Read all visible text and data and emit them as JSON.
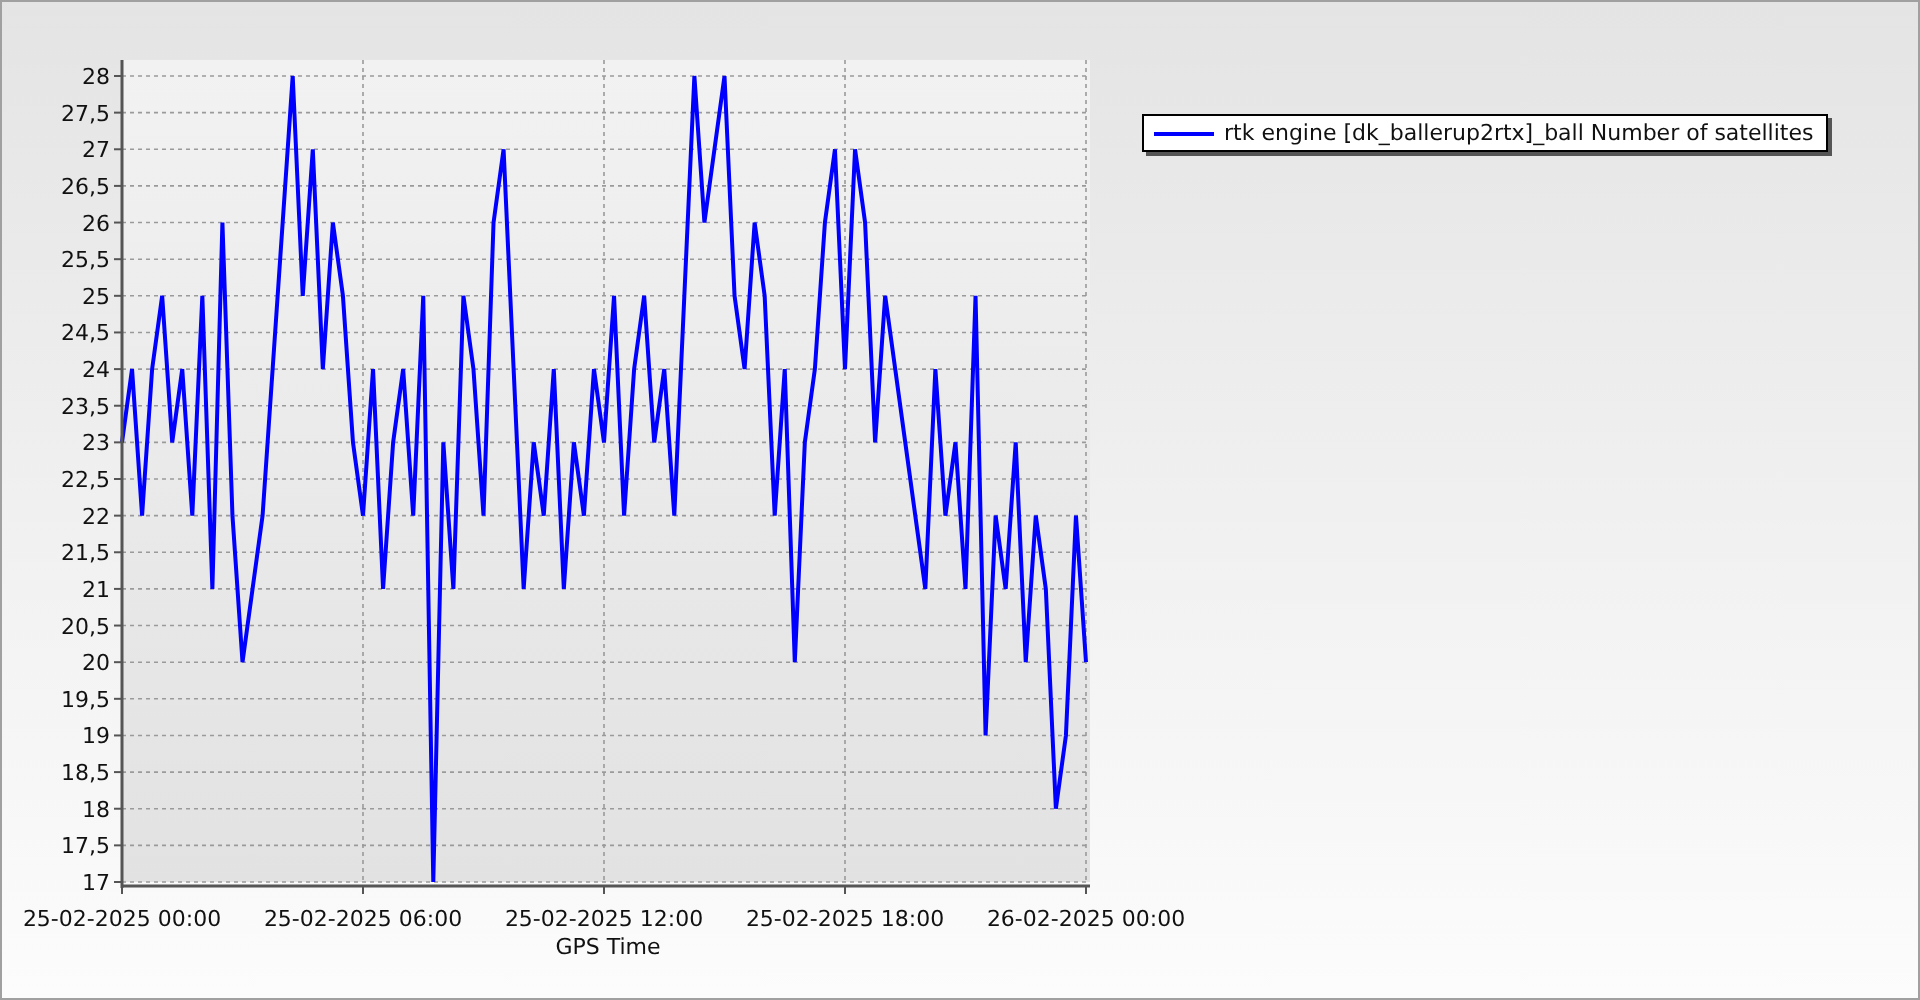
{
  "chart_data": {
    "type": "line",
    "xlabel": "GPS Time",
    "categories": [
      "25-02-2025 00:00",
      null,
      null,
      null,
      null,
      null,
      null,
      null,
      null,
      null,
      null,
      null,
      null,
      null,
      null,
      null,
      null,
      null,
      null,
      null,
      null,
      null,
      null,
      null,
      "25-02-2025 06:00",
      null,
      null,
      null,
      null,
      null,
      null,
      null,
      null,
      null,
      null,
      null,
      null,
      null,
      null,
      null,
      null,
      null,
      null,
      null,
      null,
      null,
      null,
      null,
      "25-02-2025 12:00",
      null,
      null,
      null,
      null,
      null,
      null,
      null,
      null,
      null,
      null,
      null,
      null,
      null,
      null,
      null,
      null,
      null,
      null,
      null,
      null,
      null,
      null,
      null,
      "25-02-2025 18:00",
      null,
      null,
      null,
      null,
      null,
      null,
      null,
      null,
      null,
      null,
      null,
      null,
      null,
      null,
      null,
      null,
      null,
      null,
      null,
      null,
      null,
      null,
      null,
      "26-02-2025 00:00"
    ],
    "series": [
      {
        "name": "rtk engine [dk_ballerup2rtx]_ball Number of satellites",
        "color": "#0000ff",
        "values": [
          23,
          24,
          22,
          24,
          25,
          23,
          24,
          22,
          25,
          21,
          26,
          22,
          20,
          21,
          22,
          24,
          26,
          28,
          25,
          27,
          24,
          26,
          25,
          23,
          22,
          24,
          21,
          23,
          24,
          22,
          25,
          17,
          23,
          21,
          25,
          24,
          22,
          26,
          27,
          24,
          21,
          23,
          22,
          24,
          21,
          23,
          22,
          24,
          23,
          25,
          22,
          24,
          25,
          23,
          24,
          22,
          25,
          28,
          26,
          27,
          28,
          25,
          24,
          26,
          25,
          22,
          24,
          20,
          23,
          24,
          26,
          27,
          24,
          27,
          26,
          23,
          25,
          24,
          23,
          22,
          21,
          24,
          22,
          23,
          21,
          25,
          19,
          22,
          21,
          23,
          20,
          22,
          21,
          18,
          19,
          22,
          20
        ]
      }
    ],
    "ylim": [
      17,
      28
    ],
    "grid": true,
    "yticks": [
      {
        "value": 17,
        "label": "17"
      },
      {
        "value": 17.5,
        "label": "17,5"
      },
      {
        "value": 18,
        "label": "18"
      },
      {
        "value": 18.5,
        "label": "18,5"
      },
      {
        "value": 19,
        "label": "19"
      },
      {
        "value": 19.5,
        "label": "19,5"
      },
      {
        "value": 20,
        "label": "20"
      },
      {
        "value": 20.5,
        "label": "20,5"
      },
      {
        "value": 21,
        "label": "21"
      },
      {
        "value": 21.5,
        "label": "21,5"
      },
      {
        "value": 22,
        "label": "22"
      },
      {
        "value": 22.5,
        "label": "22,5"
      },
      {
        "value": 23,
        "label": "23"
      },
      {
        "value": 23.5,
        "label": "23,5"
      },
      {
        "value": 24,
        "label": "24"
      },
      {
        "value": 24.5,
        "label": "24,5"
      },
      {
        "value": 25,
        "label": "25"
      },
      {
        "value": 25.5,
        "label": "25,5"
      },
      {
        "value": 26,
        "label": "26"
      },
      {
        "value": 26.5,
        "label": "26,5"
      },
      {
        "value": 27,
        "label": "27"
      },
      {
        "value": 27.5,
        "label": "27,5"
      },
      {
        "value": 28,
        "label": "28"
      }
    ]
  }
}
